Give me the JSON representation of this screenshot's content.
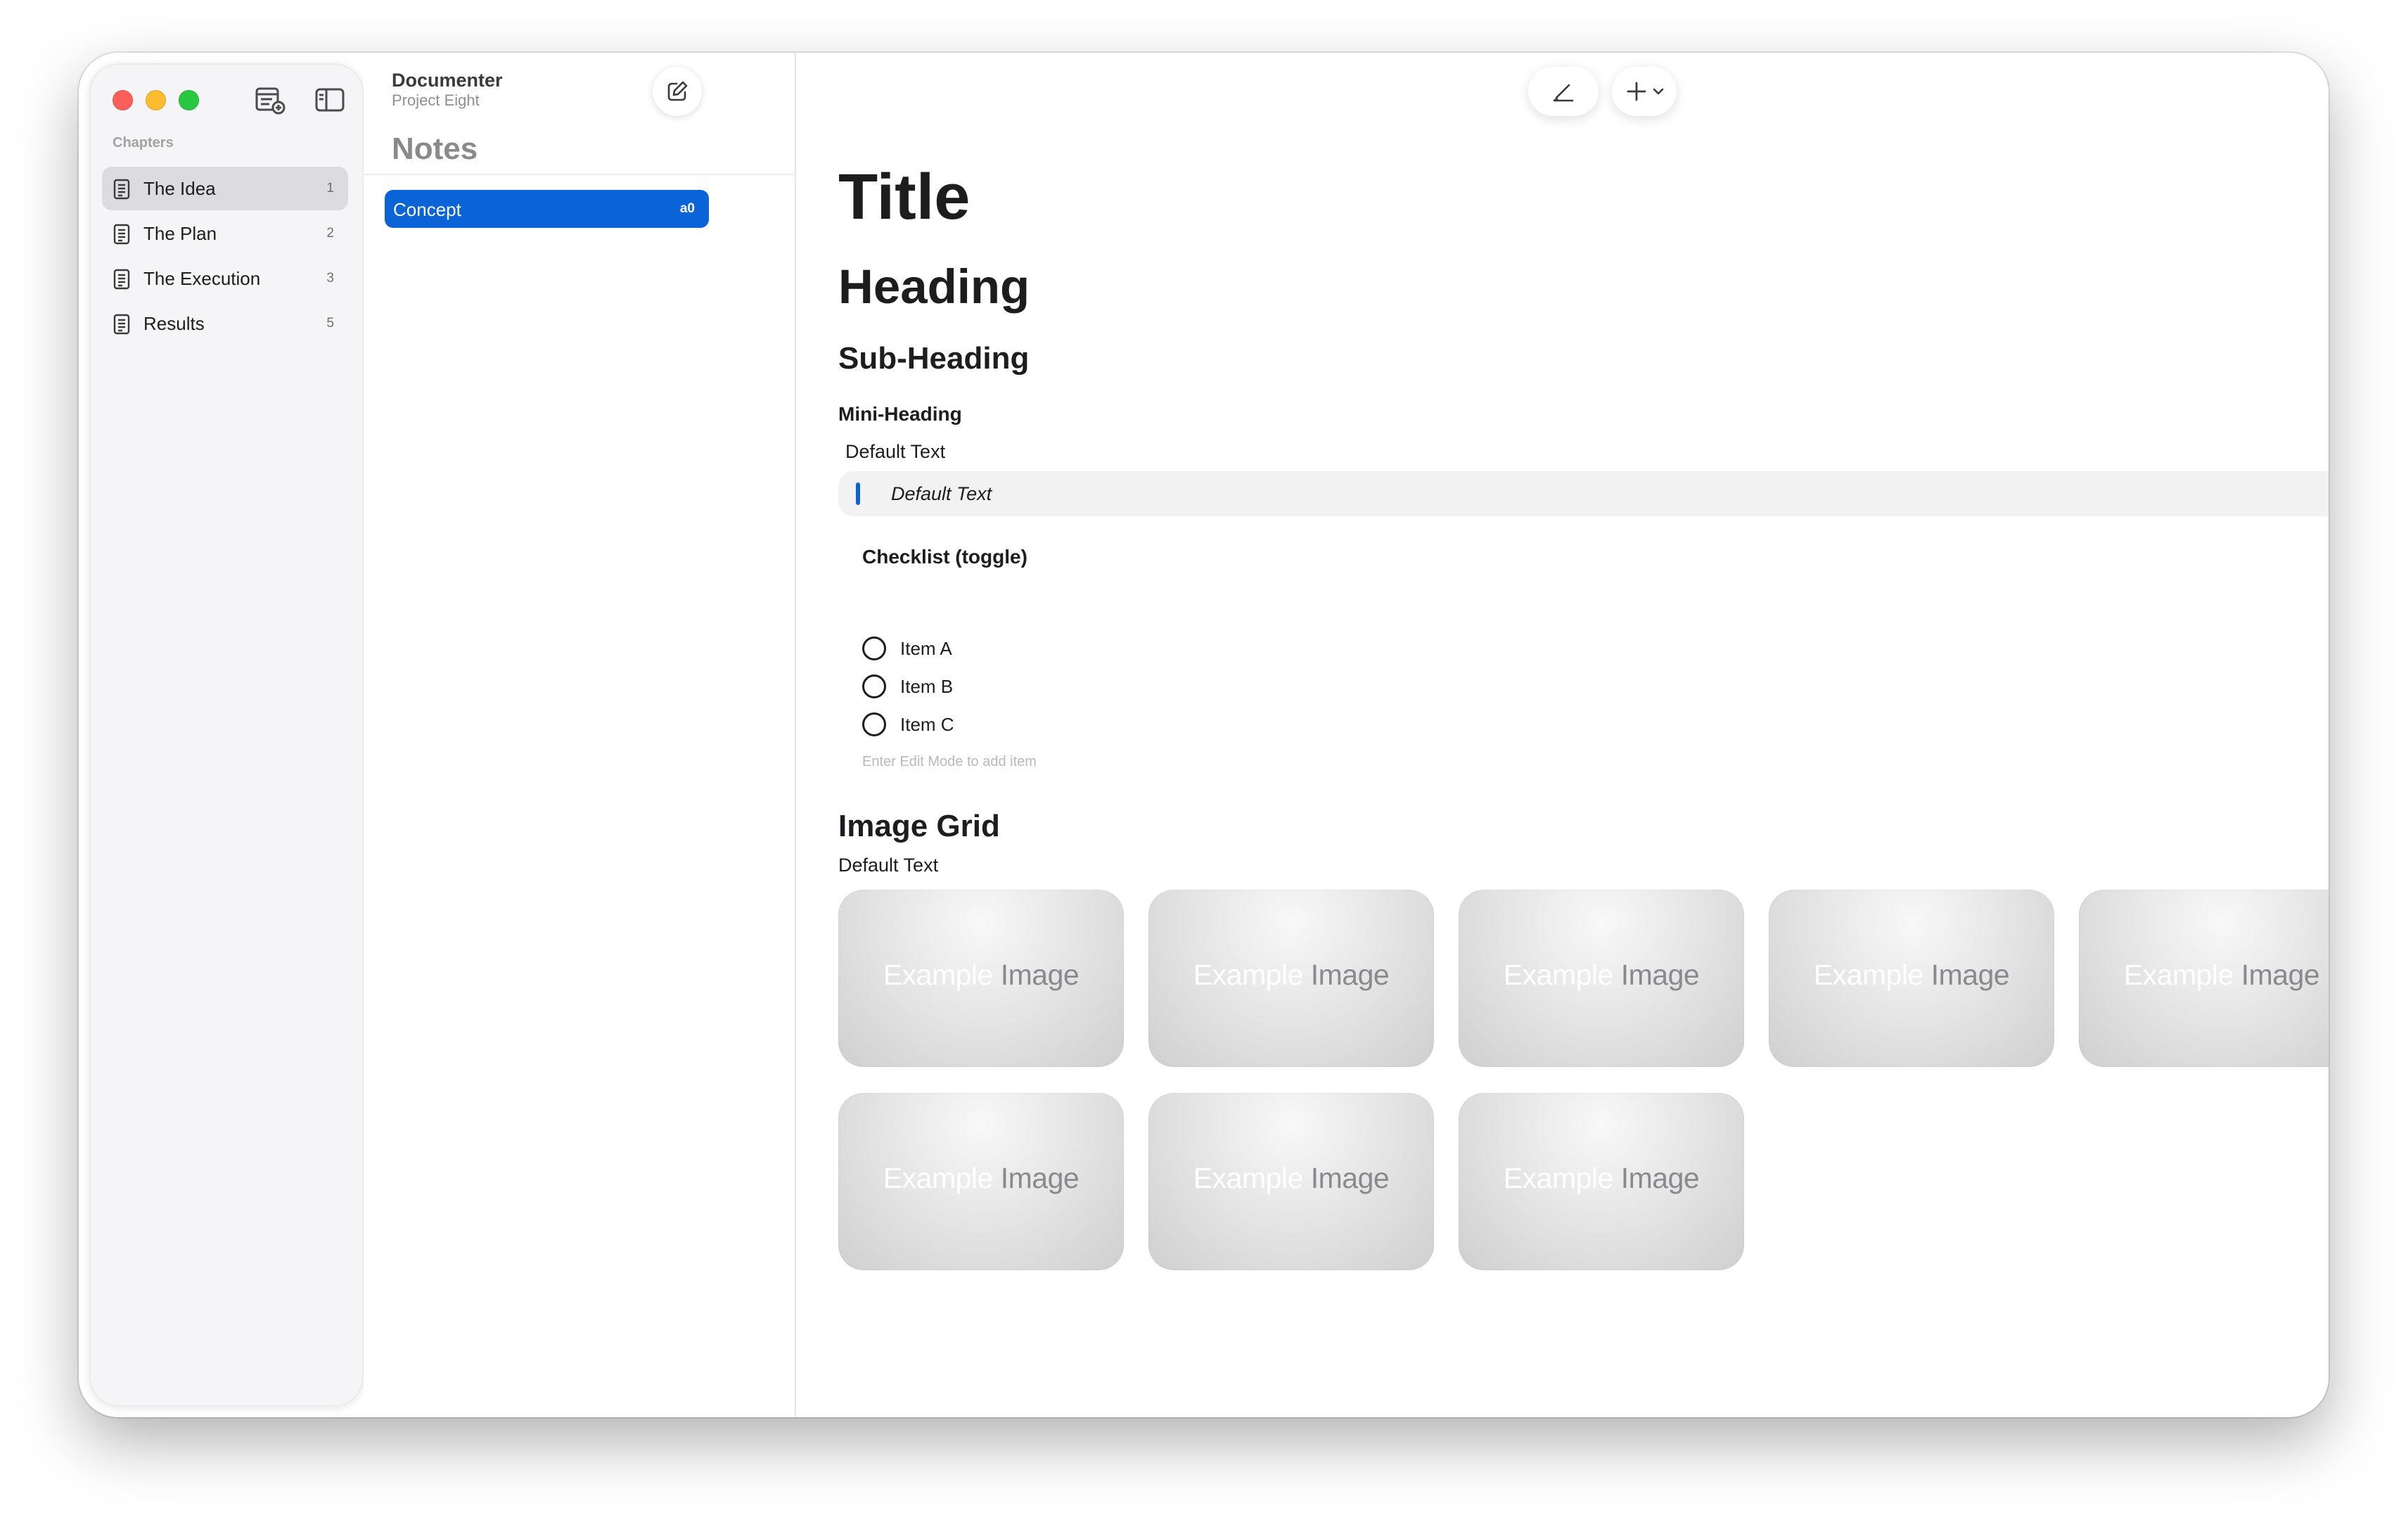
{
  "sidebar": {
    "section_label": "Chapters",
    "chapters": [
      {
        "label": "The Idea",
        "count": "1",
        "selected": true
      },
      {
        "label": "The Plan",
        "count": "2"
      },
      {
        "label": "The Execution",
        "count": "3"
      },
      {
        "label": "Results",
        "count": "5"
      }
    ],
    "toolbar_icons": [
      "new-chapter-icon",
      "sidebar-toggle-icon"
    ]
  },
  "notes": {
    "app_name": "Documenter",
    "project_name": "Project Eight",
    "title": "Notes",
    "items": [
      {
        "label": "Concept",
        "badge": "a0",
        "selected": true
      }
    ],
    "compose_icon": "compose-icon"
  },
  "toolbar": {
    "edit_icon": "pencil-icon",
    "add_icon": "plus-icon",
    "add_menu_icon": "chevron-down-icon"
  },
  "document": {
    "title": "Title",
    "heading": "Heading",
    "sub_heading": "Sub-Heading",
    "mini_heading": "Mini-Heading",
    "default_text": "Default Text",
    "quote_text": "Default Text",
    "checklist": {
      "title": "Checklist (toggle)",
      "items": [
        {
          "label": "Item A",
          "checked": false
        },
        {
          "label": "Item B",
          "checked": false
        },
        {
          "label": "Item C",
          "checked": false
        }
      ],
      "hint": "Enter Edit Mode to add item"
    },
    "image_grid": {
      "title": "Image Grid",
      "text": "Default Text",
      "images": [
        {
          "caption_light": "Example",
          "caption_dark": "Image"
        },
        {
          "caption_light": "Example",
          "caption_dark": "Image"
        },
        {
          "caption_light": "Example",
          "caption_dark": "Image"
        },
        {
          "caption_light": "Example",
          "caption_dark": "Image"
        },
        {
          "caption_light": "Example",
          "caption_dark": "Image"
        },
        {
          "caption_light": "Example",
          "caption_dark": "Image"
        },
        {
          "caption_light": "Example",
          "caption_dark": "Image"
        },
        {
          "caption_light": "Example",
          "caption_dark": "Image"
        }
      ]
    }
  },
  "colors": {
    "accent": "#0a64d8",
    "close": "#ff5f57",
    "minimize": "#febc2e",
    "zoom": "#28c840"
  }
}
